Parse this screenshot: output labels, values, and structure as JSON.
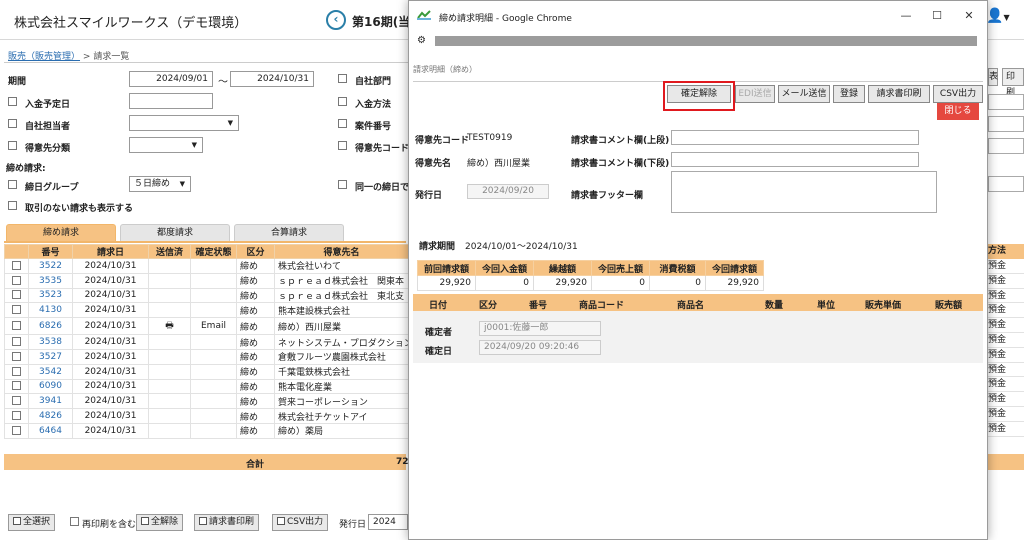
{
  "app": {
    "title": "株式会社スマイルワークス（デモ環境）",
    "period": "第16期(当",
    "user_icon": "person-icon"
  },
  "breadcrumb": {
    "parent": "販売（販売管理）",
    "sep": ">",
    "current": "請求一覧"
  },
  "filters": {
    "period_label": "期間",
    "period_from": "2024/09/01",
    "period_tilde": "～",
    "period_to": "2024/10/31",
    "due_date_label": "入金予定日",
    "staff_label": "自社担当者",
    "customer_class_label": "得意先分類",
    "closing_label": "締め請求:",
    "closing_group_label": "締日グループ",
    "closing_group_value": "５日締め",
    "show_no_txn_label": "取引のない請求も表示する",
    "dept_label": "自社部門",
    "payment_method_label": "入金方法",
    "project_label": "案件番号",
    "customer_code_label": "得意先コード",
    "same_closing_label": "同一の締日で"
  },
  "tabs": [
    "締め請求",
    "都度請求",
    "合算請求"
  ],
  "table": {
    "headers": [
      "番号",
      "請求日",
      "送信済",
      "確定状態",
      "区分",
      "得意先名"
    ],
    "rows": [
      {
        "no": "3522",
        "date": "2024/10/31",
        "sent": "",
        "status": "",
        "kind": "締め",
        "customer": "株式会社いわて"
      },
      {
        "no": "3535",
        "date": "2024/10/31",
        "sent": "",
        "status": "",
        "kind": "締め",
        "customer": "ｓｐｒｅａｄ株式会社　関東本"
      },
      {
        "no": "3523",
        "date": "2024/10/31",
        "sent": "",
        "status": "",
        "kind": "締め",
        "customer": "ｓｐｒｅａｄ株式会社　東北支"
      },
      {
        "no": "4130",
        "date": "2024/10/31",
        "sent": "",
        "status": "",
        "kind": "締め",
        "customer": "熊本建設株式会社"
      },
      {
        "no": "6826",
        "date": "2024/10/31",
        "sent": "print",
        "status": "Email",
        "kind": "締め",
        "customer": "締め）西川屋業"
      },
      {
        "no": "3538",
        "date": "2024/10/31",
        "sent": "",
        "status": "",
        "kind": "締め",
        "customer": "ネットシステム・プロダクション　栃木ブ"
      },
      {
        "no": "3527",
        "date": "2024/10/31",
        "sent": "",
        "status": "",
        "kind": "締め",
        "customer": "倉敷フルーツ農園株式会社"
      },
      {
        "no": "3542",
        "date": "2024/10/31",
        "sent": "",
        "status": "",
        "kind": "締め",
        "customer": "千葉電鉄株式会社"
      },
      {
        "no": "6090",
        "date": "2024/10/31",
        "sent": "",
        "status": "",
        "kind": "締め",
        "customer": "熊本電化産業"
      },
      {
        "no": "3941",
        "date": "2024/10/31",
        "sent": "",
        "status": "",
        "kind": "締め",
        "customer": "賀来コーポレーション"
      },
      {
        "no": "4826",
        "date": "2024/10/31",
        "sent": "",
        "status": "",
        "kind": "締め",
        "customer": "株式会社チケットアイ"
      },
      {
        "no": "6464",
        "date": "2024/10/31",
        "sent": "",
        "status": "",
        "kind": "締め",
        "customer": "締め）薬局"
      }
    ],
    "total_label": "合計",
    "total_value": "72",
    "right_header": "方法",
    "right_values": [
      "預金",
      "預金",
      "預金",
      "預金",
      "預金",
      "預金",
      "預金",
      "預金",
      "預金",
      "預金",
      "預金",
      "預金"
    ]
  },
  "right_buttons": [
    "表",
    "印刷"
  ],
  "bottom": {
    "select_all": "全選択",
    "reprint_label": "再印刷を含む",
    "deselect_all": "全解除",
    "print_invoice": "請求書印刷",
    "csv": "CSV出力",
    "issue_date_label": "発行日",
    "issue_date_value": "2024"
  },
  "popup": {
    "window_title": "締め請求明細 - Google Chrome",
    "subtitle": "請求明細（締め）",
    "buttons": {
      "unconfirm": "確定解除",
      "edi": "EDI送信",
      "mail": "メール送信",
      "register": "登録",
      "print": "請求書印刷",
      "csv": "CSV出力",
      "close": "閉じる"
    },
    "customer_code_label": "得意先コード",
    "customer_code": "TEST0919",
    "customer_name_label": "得意先名",
    "customer_name": "締め）西川屋業",
    "issue_date_label": "発行日",
    "issue_date": "2024/09/20",
    "comment_upper_label": "請求書コメント欄(上段)",
    "comment_lower_label": "請求書コメント欄(下段)",
    "footer_label": "請求書フッター欄",
    "billing_period_label": "請求期間",
    "billing_period": "2024/10/01～2024/10/31",
    "summary_headers": [
      "前回請求額",
      "今回入金額",
      "繰越額",
      "今回売上額",
      "消費税額",
      "今回請求額"
    ],
    "summary_values": [
      "29,920",
      "0",
      "29,920",
      "0",
      "0",
      "29,920"
    ],
    "detail_headers": [
      "日付",
      "区分",
      "番号",
      "商品コード",
      "商品名",
      "数量",
      "単位",
      "販売単価",
      "販売額"
    ],
    "confirmer_label": "確定者",
    "confirmer": "j0001:佐藤一郎",
    "confirmed_date_label": "確定日",
    "confirmed_date": "2024/09/20 09:20:46"
  },
  "colors": {
    "accent_orange": "#f6c283",
    "link_blue": "#2a6db0",
    "close_red": "#e5483f",
    "highlight_red": "#e0191e"
  }
}
